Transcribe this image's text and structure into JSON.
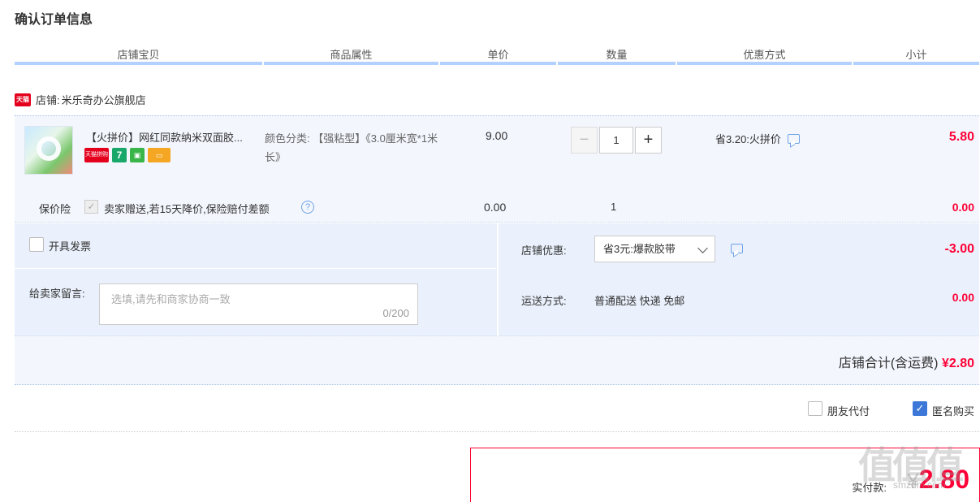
{
  "page_title": "确认订单信息",
  "columns": [
    "店铺宝贝",
    "商品属性",
    "单价",
    "数量",
    "优惠方式",
    "小计"
  ],
  "shop": {
    "logo_text": "天猫",
    "label": "店铺:",
    "name": "米乐奇办公旗舰店"
  },
  "item": {
    "title": "【火拼价】网红同款纳米双面胶...",
    "badges": [
      "天猫拼购",
      "7",
      "",
      ""
    ],
    "attr": "颜色分类: 【强粘型】《3.0厘米宽*1米长》",
    "unit_price": "9.00",
    "qty_minus": "−",
    "qty": "1",
    "qty_plus": "+",
    "promo": "省3.20:火拼价",
    "subtotal": "5.80"
  },
  "insurance": {
    "label": "保价险",
    "check": "✓",
    "desc": "卖家赠送,若15天降价,保险赔付差额",
    "help": "?",
    "price": "0.00",
    "qty": "1",
    "subtotal": "0.00"
  },
  "options": {
    "invoice_label": "开具发票",
    "message_label": "给卖家留言:",
    "message_placeholder": "选填,请先和商家协商一致",
    "message_count": "0/200",
    "discount_label": "店铺优惠:",
    "discount_selected": "省3元:爆款胶带",
    "discount_value": "-3.00",
    "shipping_label": "运送方式:",
    "shipping_value": "普通配送 快递 免邮",
    "shipping_fee": "0.00"
  },
  "shop_total": {
    "label": "店铺合计(含运费)",
    "amount": "¥2.80"
  },
  "extras": {
    "friend_pay": "朋友代付",
    "anonymous": "匿名购买",
    "anonymous_check": "✓"
  },
  "payment": {
    "label": "实付款:",
    "currency": "¥",
    "amount": "2.80"
  },
  "watermark": {
    "logo": "值值值",
    "url": "smzdm.com"
  },
  "colors": {
    "accent": "#ff0036",
    "header_bar": "#b2d1ff",
    "row_bg": "#f3f6fd",
    "options_bg": "#eaf1fc",
    "check": "#3d78d8"
  },
  "icons": [
    "tmall-logo",
    "chat-icon",
    "help-icon",
    "chevron-down-icon",
    "check-icon"
  ]
}
